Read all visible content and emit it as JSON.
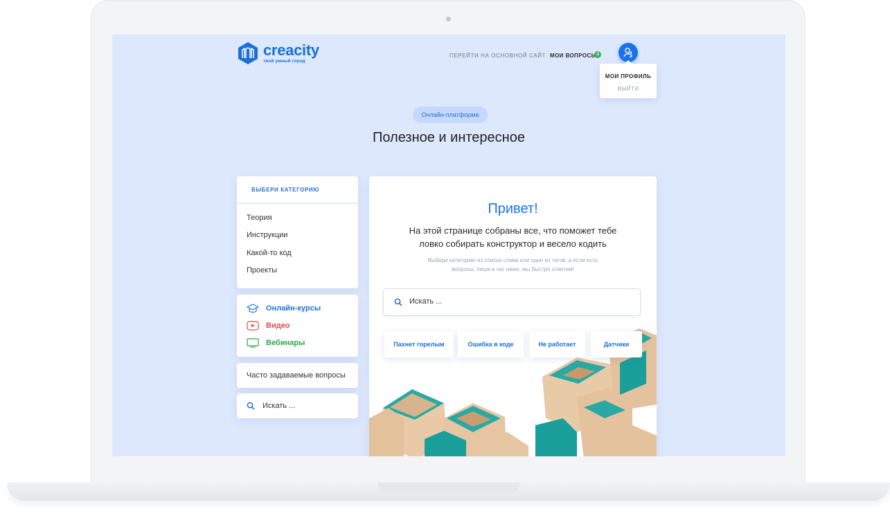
{
  "colors": {
    "accent": "#1a73e8",
    "video": "#e34a4a",
    "webinar": "#2aa84a",
    "background": "#dde8fd"
  },
  "header": {
    "logo_name": "creacity",
    "logo_tagline": "твой умный город",
    "nav_main_site": "ПЕРЕЙТИ НА ОСНОВНОЙ САЙТ",
    "nav_questions": "МОИ ВОПРОСЫ",
    "questions_count": "3",
    "profile_menu": {
      "profile": "МОИ ПРОФИЛЬ",
      "logout": "ВЫЙТИ"
    }
  },
  "hero": {
    "badge": "Онлайн-платформа",
    "title": "Полезное и интересное"
  },
  "sidebar": {
    "categories_header": "ВЫБЕРИ КАТЕГОРИЮ",
    "categories": [
      "Теория",
      "Инструкции",
      "Какой-то код",
      "Проекты"
    ],
    "media": [
      {
        "label": "Онлайн-курсы",
        "icon": "graduation-cap-icon",
        "color": "#1a73e8"
      },
      {
        "label": "Видео",
        "icon": "video-play-icon",
        "color": "#e34a4a"
      },
      {
        "label": "Вебинары",
        "icon": "monitor-icon",
        "color": "#2aa84a"
      }
    ],
    "faq": "Часто задаваемые вопросы",
    "search_placeholder": "Искать ..."
  },
  "main": {
    "greeting": "Привет!",
    "lead": "На этой странице собраны все, что поможет тебе ловко собирать конструктор и весело кодить",
    "hint": "Выбери категорию из списка слева или один из тегов, а если есть вопросы, пиши в чат ниже, мы быстро ответим!",
    "search_placeholder": "Искать ...",
    "tags": [
      "Пахнет горелым",
      "Ошибка в коде",
      "Не работает",
      "Датчики"
    ]
  }
}
